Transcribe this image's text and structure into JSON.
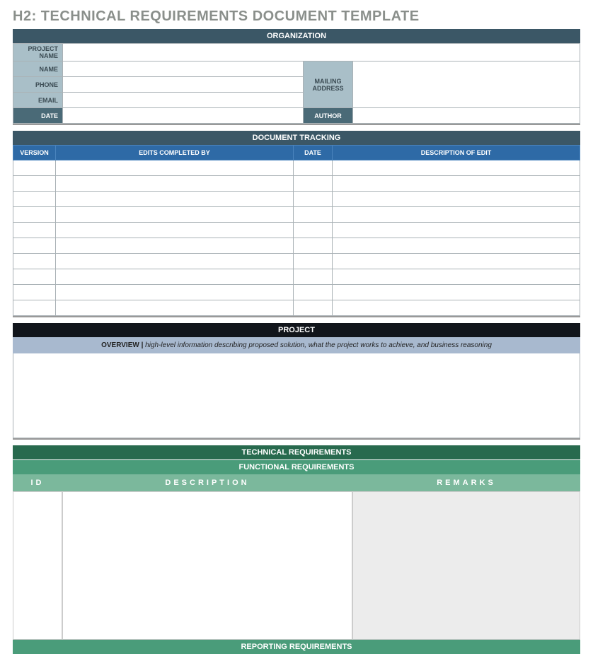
{
  "title": "H2: TECHNICAL REQUIREMENTS DOCUMENT TEMPLATE",
  "organization": {
    "header": "ORGANIZATION",
    "labels": {
      "project_name": "PROJECT NAME",
      "name": "NAME",
      "phone": "PHONE",
      "email": "EMAIL",
      "mailing_address": "MAILING ADDRESS",
      "date": "DATE",
      "author": "AUTHOR"
    },
    "values": {
      "project_name": "",
      "name": "",
      "phone": "",
      "email": "",
      "mailing_address": "",
      "date": "",
      "author": ""
    }
  },
  "tracking": {
    "header": "DOCUMENT TRACKING",
    "columns": {
      "version": "VERSION",
      "edits_by": "EDITS COMPLETED BY",
      "date": "DATE",
      "description": "DESCRIPTION OF EDIT"
    },
    "rows": 10
  },
  "project": {
    "header": "PROJECT",
    "overview_label": "OVERVIEW   |",
    "overview_hint": "high-level information describing proposed solution, what the project works to achieve, and business reasoning",
    "overview_body": ""
  },
  "technical": {
    "header": "TECHNICAL REQUIREMENTS",
    "functional_header": "FUNCTIONAL REQUIREMENTS",
    "columns": {
      "id": "ID",
      "description": "DESCRIPTION",
      "remarks": "REMARKS"
    },
    "reporting_header": "REPORTING REQUIREMENTS"
  }
}
